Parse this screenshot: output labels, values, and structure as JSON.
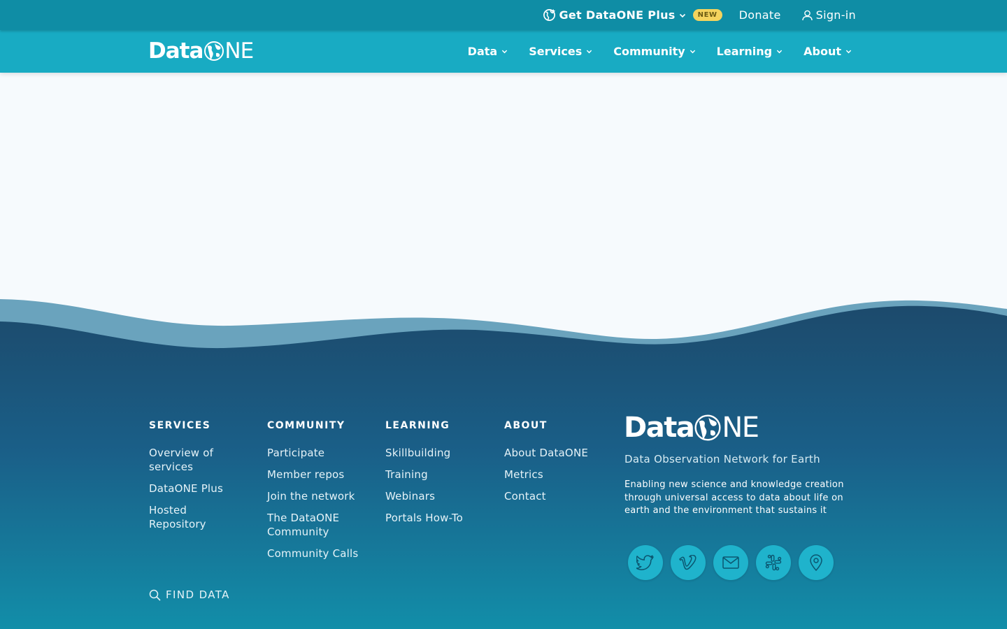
{
  "topbar": {
    "plus_label": "Get DataONE Plus",
    "plus_badge": "NEW",
    "donate_label": "Donate",
    "signin_label": "Sign-in"
  },
  "navbar": {
    "logo_text_left": "Data",
    "logo_text_right": "NE",
    "items": [
      {
        "label": "Data"
      },
      {
        "label": "Services"
      },
      {
        "label": "Community"
      },
      {
        "label": "Learning"
      },
      {
        "label": "About"
      }
    ]
  },
  "footer": {
    "columns": [
      {
        "heading": "SERVICES",
        "links": [
          "Overview of services",
          "DataONE Plus",
          "Hosted Repository"
        ]
      },
      {
        "heading": "COMMUNITY",
        "links": [
          "Participate",
          "Member repos",
          "Join the network",
          "The DataONE Community",
          "Community Calls"
        ]
      },
      {
        "heading": "LEARNING",
        "links": [
          "Skillbuilding",
          "Training",
          "Webinars",
          "Portals How-To"
        ]
      },
      {
        "heading": "ABOUT",
        "links": [
          "About DataONE",
          "Metrics",
          "Contact"
        ]
      }
    ],
    "find_data_label": "FIND DATA",
    "brand": {
      "logo_text_left": "Data",
      "logo_text_right": "NE",
      "tagline": "Data Observation Network for Earth",
      "description": "Enabling new science and knowledge creation through universal access to data about life on earth and the environment that sustains it"
    },
    "social": [
      "twitter-icon",
      "vimeo-icon",
      "mail-icon",
      "slack-icon",
      "location-pin-icon"
    ]
  },
  "colors": {
    "topbar": "#0f8da5",
    "navbar": "#18abc3",
    "page_bg": "#f6fafd",
    "wave_light": "#6aa3bd",
    "footer_top": "#1c4a6c",
    "footer_bottom": "#128ea9",
    "social_button": "#1fb3cc",
    "badge": "#f4d35e"
  }
}
